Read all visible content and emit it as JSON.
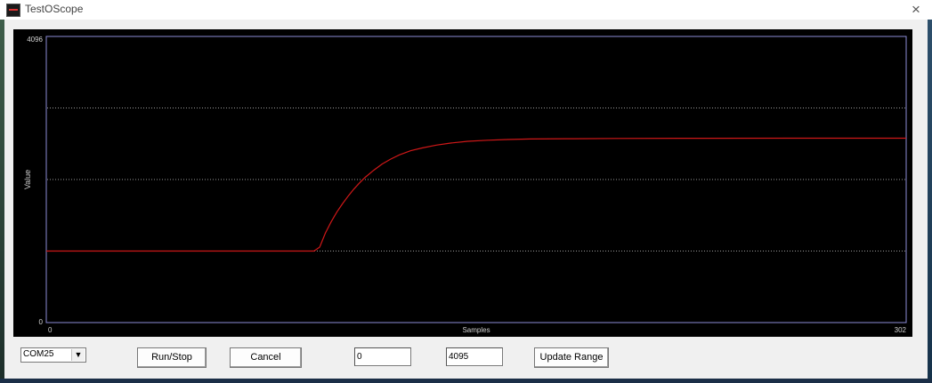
{
  "window": {
    "title": "TestOScope",
    "close_symbol": "×"
  },
  "chart_data": {
    "type": "line",
    "title": "",
    "xlabel": "Samples",
    "ylabel": "Value",
    "xlim": [
      0,
      302
    ],
    "ylim": [
      0,
      4096
    ],
    "x_tick_labels": [
      "0",
      "302"
    ],
    "y_tick_labels": [
      "0",
      "4096"
    ],
    "grid": "horizontal dotted",
    "series": [
      {
        "color": "#d01818",
        "x": [
          0,
          94,
          96,
          98,
          100,
          102,
          104,
          106,
          108,
          110,
          112,
          115,
          118,
          121,
          124,
          128,
          132,
          137,
          142,
          148,
          155,
          162,
          170,
          185,
          200,
          230,
          260,
          302
        ],
        "y": [
          1024,
          1024,
          1080,
          1280,
          1440,
          1580,
          1700,
          1810,
          1910,
          2000,
          2080,
          2180,
          2270,
          2340,
          2400,
          2460,
          2500,
          2540,
          2570,
          2595,
          2610,
          2620,
          2628,
          2632,
          2636,
          2638,
          2640,
          2640
        ]
      }
    ]
  },
  "controls": {
    "port_select": {
      "value": "COM25",
      "arrow": "▼"
    },
    "run_stop_label": "Run/Stop",
    "cancel_label": "Cancel",
    "range_min": "0",
    "range_max": "4095",
    "update_range_label": "Update Range"
  }
}
